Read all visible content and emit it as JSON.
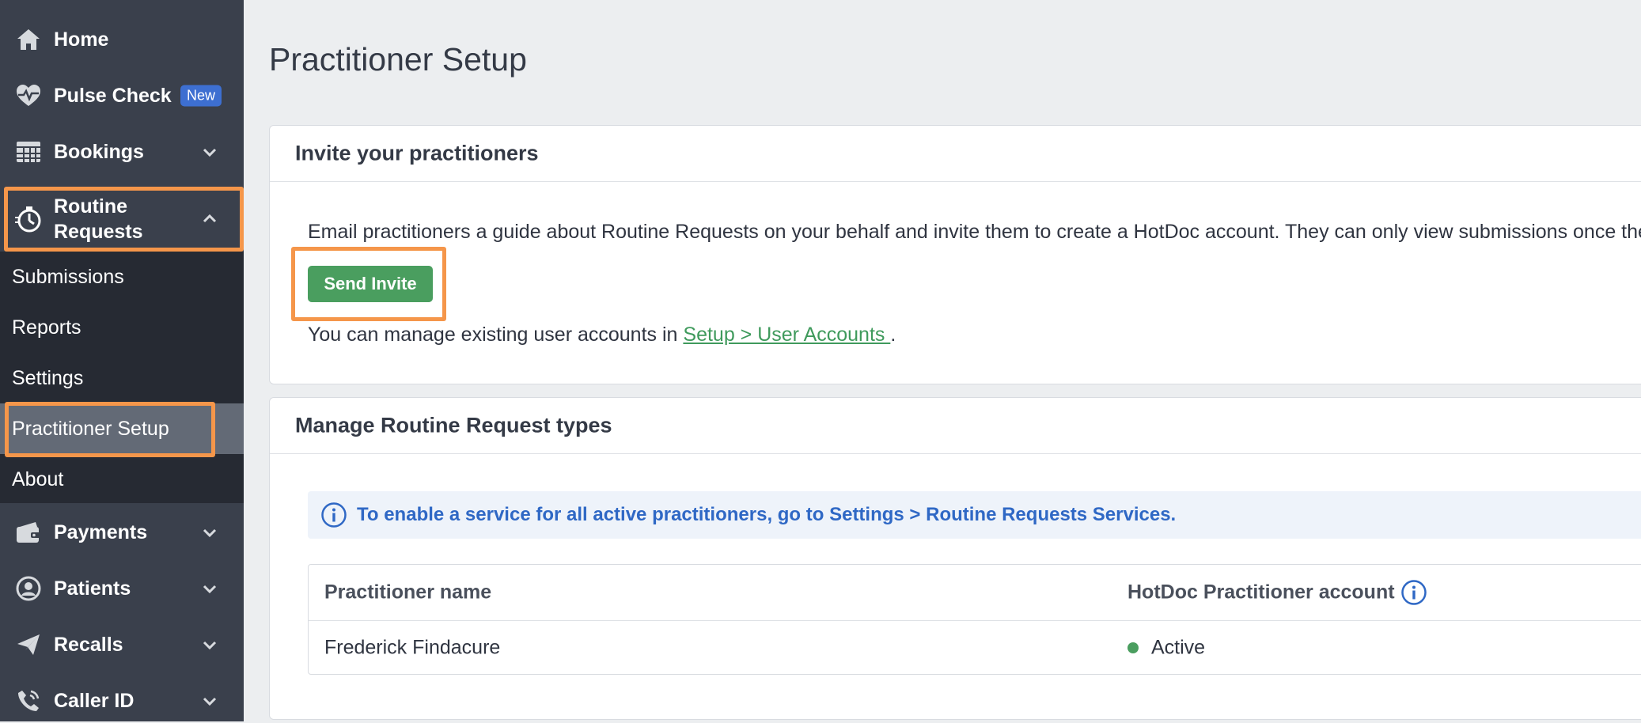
{
  "sidebar": {
    "items": {
      "home": {
        "label": "Home",
        "icon": "home-icon"
      },
      "pulse_check": {
        "label": "Pulse Check",
        "badge": "New",
        "icon": "heartbeat-icon"
      },
      "bookings": {
        "label": "Bookings",
        "icon": "calendar-grid-icon"
      },
      "routine_requests": {
        "label_line1": "Routine",
        "label_line2": "Requests",
        "icon": "stopwatch-icon",
        "expanded": true
      },
      "payments": {
        "label": "Payments",
        "icon": "wallet-icon"
      },
      "patients": {
        "label": "Patients",
        "icon": "user-circle-icon"
      },
      "recalls": {
        "label": "Recalls",
        "icon": "paper-plane-icon"
      },
      "caller_id": {
        "label": "Caller ID",
        "icon": "phone-icon"
      }
    },
    "submenu": {
      "submissions": "Submissions",
      "reports": "Reports",
      "settings": "Settings",
      "practitioner_setup": "Practitioner Setup",
      "about": "About"
    },
    "active_item": "Practitioner Setup"
  },
  "main": {
    "title": "Practitioner Setup",
    "invite": {
      "heading": "Invite your practitioners",
      "description": "Email practitioners a guide about Routine Requests on your behalf and invite them to create a HotDoc account. They can only view submissions once they",
      "button": "Send Invite",
      "manage_prefix": "You can manage existing user accounts in ",
      "manage_link": "Setup > User Accounts ",
      "manage_suffix": "."
    },
    "types": {
      "heading": "Manage Routine Request types",
      "info": "To enable a service for all active practitioners, go to Settings > Routine Requests Services.",
      "table": {
        "col_name": "Practitioner name",
        "col_account": "HotDoc Practitioner account",
        "rows": [
          {
            "name": "Frederick Findacure",
            "status": "Active"
          }
        ]
      }
    }
  },
  "colors": {
    "sidebar_bg": "#3a404c",
    "submenu_bg": "#262a33",
    "accent_green": "#4a9e5f",
    "info_blue": "#2f68c5",
    "highlight_orange": "#f5964a",
    "new_badge": "#3d6fd1",
    "status_active": "#4a9e5f"
  }
}
